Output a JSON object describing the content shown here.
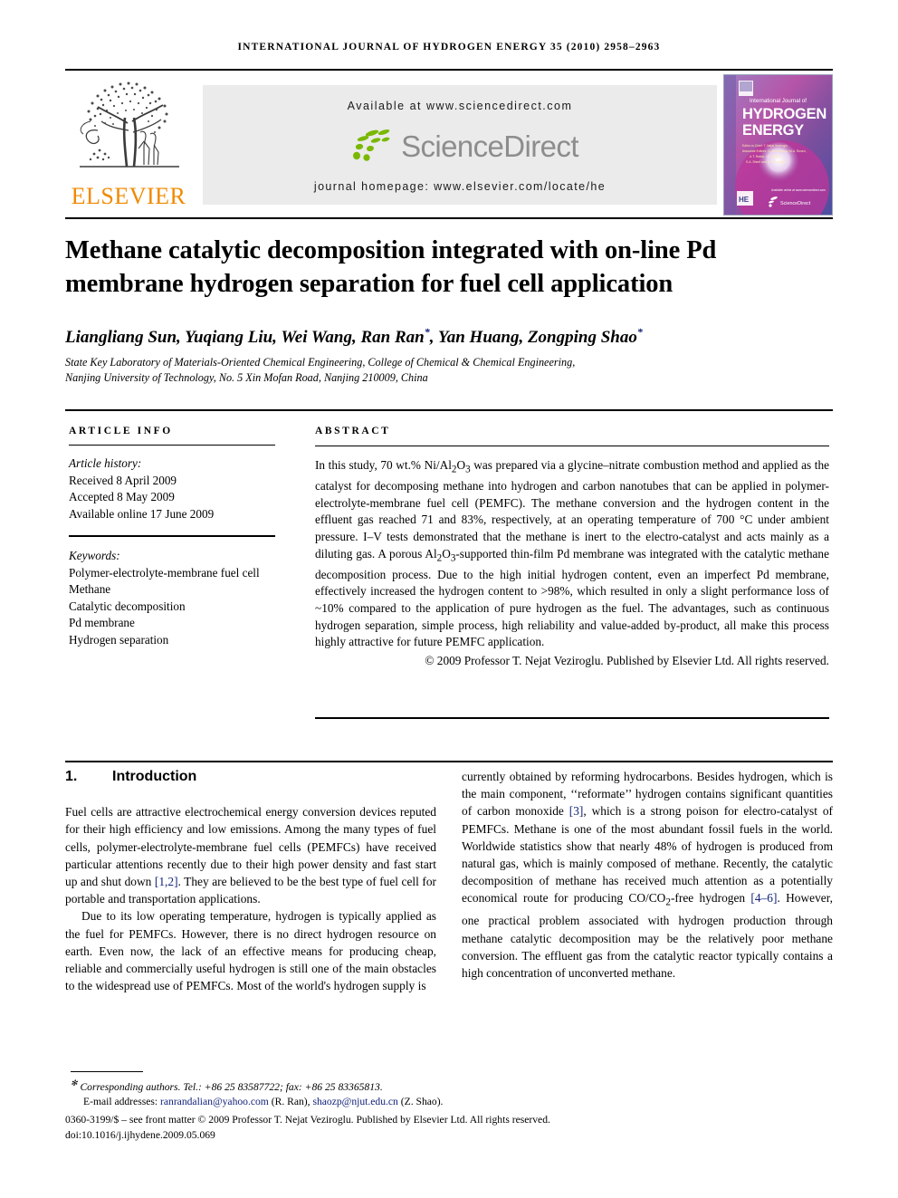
{
  "running_head": "International Journal of Hydrogen Energy 35 (2010) 2958–2963",
  "masthead": {
    "publisher_name": "ELSEVIER",
    "publisher_logo_name": "elsevier-tree-logo",
    "available_at": "Available at www.sciencedirect.com",
    "sciencedirect_label": "ScienceDirect",
    "journal_homepage": "journal homepage: www.elsevier.com/locate/he",
    "cover": {
      "line1": "International Journal of",
      "line2": "HYDROGEN",
      "line3": "ENERGY",
      "editor_line1": "Editor-in-Chief:  T. Nejat Veziroğlu",
      "editor_line2": "Associate Editors: D. Bessarabov, M.A. Rosen,",
      "editor_line3": "A.T. Raissi, I.E. Wachs,",
      "editor_line4": "S.A. Sherif and R.F. Probstein",
      "footer_label": "ScienceDirect"
    }
  },
  "article": {
    "title": "Methane catalytic decomposition integrated with on-line Pd membrane hydrogen separation for fuel cell application",
    "authors_html": "Liangliang Sun, Yuqiang Liu, Wei Wang, Ran Ran*, Yan Huang, Zongping Shao*",
    "affiliation_line1": "State Key Laboratory of Materials-Oriented Chemical Engineering, College of Chemical & Chemical Engineering,",
    "affiliation_line2": "Nanjing University of Technology, No. 5 Xin Mofan Road, Nanjing 210009, China"
  },
  "article_info": {
    "heading": "ARTICLE INFO",
    "history_label": "Article history:",
    "history": [
      "Received 8 April 2009",
      "Accepted 8 May 2009",
      "Available online 17 June 2009"
    ],
    "keywords_label": "Keywords:",
    "keywords": [
      "Polymer-electrolyte-membrane fuel cell",
      "Methane",
      "Catalytic decomposition",
      "Pd membrane",
      "Hydrogen separation"
    ]
  },
  "abstract": {
    "heading": "ABSTRACT",
    "text": "In this study, 70 wt.% Ni/Al2O3 was prepared via a glycine–nitrate combustion method and applied as the catalyst for decomposing methane into hydrogen and carbon nanotubes that can be applied in polymer-electrolyte-membrane fuel cell (PEMFC). The methane conversion and the hydrogen content in the effluent gas reached 71 and 83%, respectively, at an operating temperature of 700 °C under ambient pressure. I–V tests demonstrated that the methane is inert to the electro-catalyst and acts mainly as a diluting gas. A porous Al2O3-supported thin-film Pd membrane was integrated with the catalytic methane decomposition process. Due to the high initial hydrogen content, even an imperfect Pd membrane, effectively increased the hydrogen content to >98%, which resulted in only a slight performance loss of ~10% compared to the application of pure hydrogen as the fuel. The advantages, such as continuous hydrogen separation, simple process, high reliability and value-added by-product, all make this process highly attractive for future PEMFC application.",
    "copyright": "© 2009 Professor T. Nejat Veziroglu. Published by Elsevier Ltd. All rights reserved."
  },
  "body": {
    "section_number": "1.",
    "section_title": "Introduction",
    "left_paragraph_1": "Fuel cells are attractive electrochemical energy conversion devices reputed for their high efficiency and low emissions. Among the many types of fuel cells, polymer-electrolyte-membrane fuel cells (PEMFCs) have received particular attentions recently due to their high power density and fast start up and shut down [1,2]. They are believed to be the best type of fuel cell for portable and transportation applications.",
    "left_paragraph_2": "Due to its low operating temperature, hydrogen is typically applied as the fuel for PEMFCs. However, there is no direct hydrogen resource on earth. Even now, the lack of an effective means for producing cheap, reliable and commercially useful hydrogen is still one of the main obstacles to the widespread use of PEMFCs. Most of the world's hydrogen supply is",
    "right_paragraph_1": "currently obtained by reforming hydrocarbons. Besides hydrogen, which is the main component, ‘‘reformate’’ hydrogen contains significant quantities of carbon monoxide [3], which is a strong poison for electro-catalyst of PEMFCs. Methane is one of the most abundant fossil fuels in the world. Worldwide statistics show that nearly 48% of hydrogen is produced from natural gas, which is mainly composed of methane. Recently, the catalytic decomposition of methane has received much attention as a potentially economical route for producing CO/CO2-free hydrogen [4–6]. However, one practical problem associated with hydrogen production through methane catalytic decomposition may be the relatively poor methane conversion. The effluent gas from the catalytic reactor typically contains a high concentration of unconverted methane.",
    "refs": {
      "r12": "[1,2]",
      "r3": "[3]",
      "r46": "[4–6]"
    }
  },
  "footer": {
    "corresponding": "Corresponding authors. Tel.: +86 25 83587722; fax: +86 25 83365813.",
    "email_label": "E-mail addresses:",
    "email1": "ranrandalian@yahoo.com",
    "email1_owner": "(R. Ran),",
    "email2": "shaozp@njut.edu.cn",
    "email2_owner": "(Z. Shao).",
    "issn_line": "0360-3199/$ – see front matter © 2009 Professor T. Nejat Veziroglu. Published by Elsevier Ltd. All rights reserved.",
    "doi_line": "doi:10.1016/j.ijhydene.2009.05.069"
  },
  "colors": {
    "link": "#12227a",
    "elsevier_orange": "#F08A00",
    "sciencedirect_gray": "#8d8d8d",
    "sciencedirect_green": "#7ab800",
    "band_background": "#ebebeb",
    "cover_magenta": "#c0349b",
    "cover_blue": "#4a4fa0"
  }
}
